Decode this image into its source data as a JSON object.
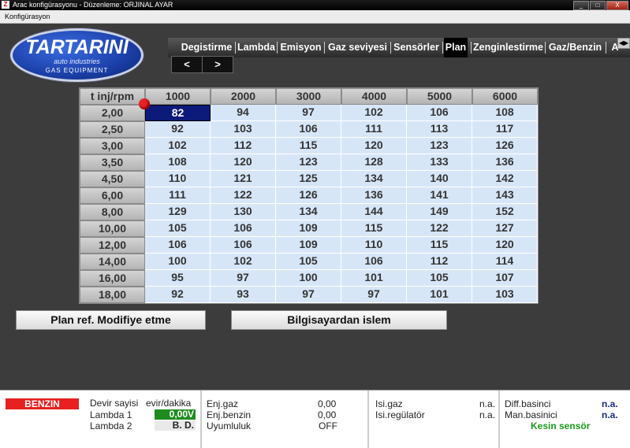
{
  "titlebar": {
    "app_icon": "Z",
    "title": "Arac konfigürasyonu - Düzenleme: ORJINAL AYAR",
    "buttons": {
      "minimize": "_",
      "maximize": "□",
      "close": "X"
    }
  },
  "menubar": {
    "items": [
      "Konfigürasyon"
    ]
  },
  "logo": {
    "brand": "TARTARINI",
    "tagline": "auto industries",
    "subtitle": "GAS EQUIPMENT"
  },
  "tabs": [
    {
      "label": "Degistirme",
      "active": false
    },
    {
      "label": "Lambda",
      "active": false
    },
    {
      "label": "Emisyon",
      "active": false
    },
    {
      "label": "Gaz seviyesi",
      "active": false
    },
    {
      "label": "Sensörler",
      "active": false
    },
    {
      "label": "Plan",
      "active": true
    },
    {
      "label": "Zenginlestirme",
      "active": false
    },
    {
      "label": "Gaz/Benzin",
      "active": false
    },
    {
      "label": "A",
      "active": false
    }
  ],
  "tab_scroll": {
    "icon": "scroll-arrows-icon",
    "glyph": "◀▶"
  },
  "nav": {
    "prev": "<",
    "next": ">"
  },
  "grid": {
    "corner_label": "t inj/rpm",
    "columns": [
      "1000",
      "2000",
      "3000",
      "4000",
      "5000",
      "6000"
    ],
    "rows": [
      {
        "label": "2,00",
        "values": [
          "82",
          "94",
          "97",
          "102",
          "106",
          "108"
        ]
      },
      {
        "label": "2,50",
        "values": [
          "92",
          "103",
          "106",
          "111",
          "113",
          "117"
        ]
      },
      {
        "label": "3,00",
        "values": [
          "102",
          "112",
          "115",
          "120",
          "123",
          "126"
        ]
      },
      {
        "label": "3,50",
        "values": [
          "108",
          "120",
          "123",
          "128",
          "133",
          "136"
        ]
      },
      {
        "label": "4,50",
        "values": [
          "110",
          "121",
          "125",
          "134",
          "140",
          "142"
        ]
      },
      {
        "label": "6,00",
        "values": [
          "111",
          "122",
          "126",
          "136",
          "141",
          "143"
        ]
      },
      {
        "label": "8,00",
        "values": [
          "129",
          "130",
          "134",
          "144",
          "149",
          "152"
        ]
      },
      {
        "label": "10,00",
        "values": [
          "105",
          "106",
          "109",
          "115",
          "122",
          "127"
        ]
      },
      {
        "label": "12,00",
        "values": [
          "106",
          "106",
          "109",
          "110",
          "115",
          "120"
        ]
      },
      {
        "label": "14,00",
        "values": [
          "100",
          "102",
          "105",
          "106",
          "112",
          "114"
        ]
      },
      {
        "label": "16,00",
        "values": [
          "95",
          "97",
          "100",
          "101",
          "105",
          "107"
        ]
      },
      {
        "label": "18,00",
        "values": [
          "92",
          "93",
          "97",
          "97",
          "101",
          "103"
        ]
      }
    ],
    "selected": {
      "row": 0,
      "col": 0
    },
    "selected_color": "#0c1a7a",
    "cell_color": "#d7e6f7"
  },
  "buttons": {
    "plan_ref": "Plan ref. Modifiye etme",
    "bilgisayar": "Bilgisayardan islem"
  },
  "status": {
    "fuel_mode": "BENZIN",
    "fuel_mode_color": "#e82020",
    "devir_label": "Devir sayisi",
    "devir_unit": "evir/dakika",
    "lambda1_label": "Lambda 1",
    "lambda1_value": "0,00V",
    "lambda1_color": "#1e8c1e",
    "lambda2_label": "Lambda 2",
    "lambda2_value": "B. D.",
    "enj_gaz_label": "Enj.gaz",
    "enj_gaz_value": "0,00",
    "enj_benzin_label": "Enj.benzin",
    "enj_benzin_value": "0,00",
    "uyumluluk_label": "Uyumluluk",
    "uyumluluk_value": "OFF",
    "isi_gaz_label": "Isi.gaz",
    "isi_gaz_value": "n.a.",
    "isi_reg_label": "Isi.regülatör",
    "isi_reg_value": "n.a.",
    "diff_label": "Diff.basinci",
    "diff_value": "n.a.",
    "man_label": "Man.basinici",
    "man_value": "n.a.",
    "kesin_label": "Kesin sensör",
    "kesin_color": "#1a9a1a"
  }
}
